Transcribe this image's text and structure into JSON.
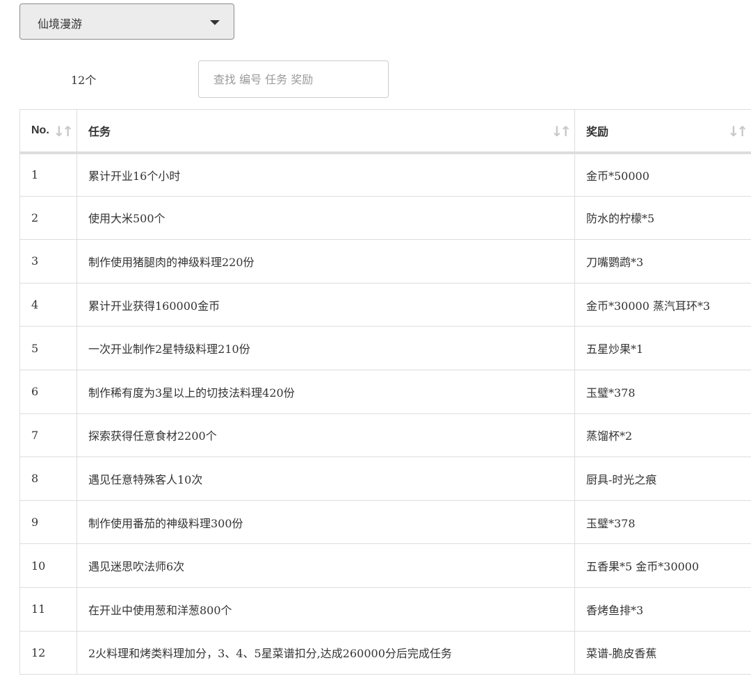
{
  "select": {
    "value": "仙境漫游"
  },
  "count": "12个",
  "search": {
    "placeholder": "查找 编号 任务 奖励"
  },
  "columns": {
    "no": "No.",
    "task": "任务",
    "reward": "奖励"
  },
  "rows": [
    {
      "no": "1",
      "task": "累计开业16个小时",
      "reward": "金币*50000"
    },
    {
      "no": "2",
      "task": "使用大米500个",
      "reward": "防水的柠檬*5"
    },
    {
      "no": "3",
      "task": "制作使用猪腿肉的神级料理220份",
      "reward": "刀嘴鹦鹉*3"
    },
    {
      "no": "4",
      "task": "累计开业获得160000金币",
      "reward": "金币*30000 蒸汽耳环*3"
    },
    {
      "no": "5",
      "task": "一次开业制作2星特级料理210份",
      "reward": "五星炒果*1"
    },
    {
      "no": "6",
      "task": "制作稀有度为3星以上的切技法料理420份",
      "reward": "玉璧*378"
    },
    {
      "no": "7",
      "task": "探索获得任意食材2200个",
      "reward": "蒸馏杯*2"
    },
    {
      "no": "8",
      "task": "遇见任意特殊客人10次",
      "reward": "厨具-时光之痕"
    },
    {
      "no": "9",
      "task": "制作使用番茄的神级料理300份",
      "reward": "玉璧*378"
    },
    {
      "no": "10",
      "task": "遇见迷思吹法师6次",
      "reward": "五香果*5 金币*30000"
    },
    {
      "no": "11",
      "task": "在开业中使用葱和洋葱800个",
      "reward": "香烤鱼排*3"
    },
    {
      "no": "12",
      "task": "2火料理和烤类料理加分，3、4、5星菜谱扣分,达成260000分后完成任务",
      "reward": "菜谱-脆皮香蕉"
    }
  ]
}
